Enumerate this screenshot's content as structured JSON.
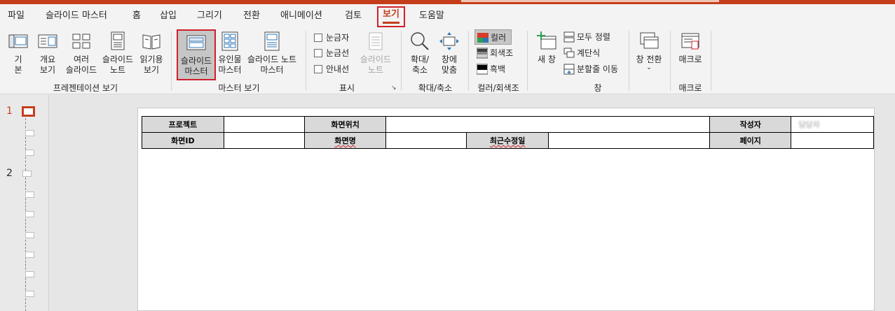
{
  "tabs": [
    "파일",
    "슬라이드 마스터",
    "홈",
    "삽입",
    "그리기",
    "전환",
    "애니메이션",
    "검토",
    "보기",
    "도움말"
  ],
  "active_tab": "보기",
  "groups": {
    "presentation_views": {
      "label": "프레젠테이션 보기",
      "buttons": [
        {
          "line1": "기",
          "line2": "본"
        },
        {
          "line1": "개요",
          "line2": "보기"
        },
        {
          "line1": "여러",
          "line2": "슬라이드"
        },
        {
          "line1": "슬라이드",
          "line2": "노트"
        },
        {
          "line1": "읽기용",
          "line2": "보기"
        }
      ]
    },
    "master_views": {
      "label": "마스터 보기",
      "buttons": [
        {
          "line1": "슬라이드",
          "line2": "마스터",
          "selected": true
        },
        {
          "line1": "유인물",
          "line2": "마스터"
        },
        {
          "line1": "슬라이드 노트",
          "line2": "마스터"
        }
      ]
    },
    "show": {
      "label": "표시",
      "checks": [
        {
          "label": "눈금자",
          "checked": false
        },
        {
          "label": "눈금선",
          "checked": false
        },
        {
          "label": "안내선",
          "checked": false
        }
      ],
      "notes_button": {
        "line1": "슬라이드",
        "line2": "노트",
        "disabled": true
      }
    },
    "zoom": {
      "label": "확대/축소",
      "buttons": [
        {
          "line1": "확대/",
          "line2": "축소"
        },
        {
          "line1": "창에",
          "line2": "맞춤"
        }
      ]
    },
    "color": {
      "label": "컬러/회색조",
      "items": [
        "컬러",
        "회색조",
        "흑백"
      ],
      "selected": "컬러"
    },
    "window": {
      "label": "창",
      "new_window": "새 창",
      "small": [
        "모두 정렬",
        "계단식",
        "분할줄 이동"
      ],
      "switch": "창 전환"
    },
    "macros": {
      "label": "매크로",
      "button": "매크로"
    }
  },
  "thumbnails": {
    "numbers": [
      "1",
      "2"
    ],
    "active": "1"
  },
  "slide_table": {
    "row1": {
      "c1": "프로젝트",
      "c2": "",
      "c3": "화면위치",
      "c4": "",
      "c5": "작성자",
      "c6": "담당자"
    },
    "row2": {
      "c1": "화면ID",
      "c2": "",
      "c3": "화면명",
      "c4": "",
      "c5": "최근수정일",
      "c6": "",
      "c7": "페이지",
      "c8": ""
    }
  },
  "colors": {
    "accent": "#c43e1c",
    "highlight": "#d0202a"
  }
}
